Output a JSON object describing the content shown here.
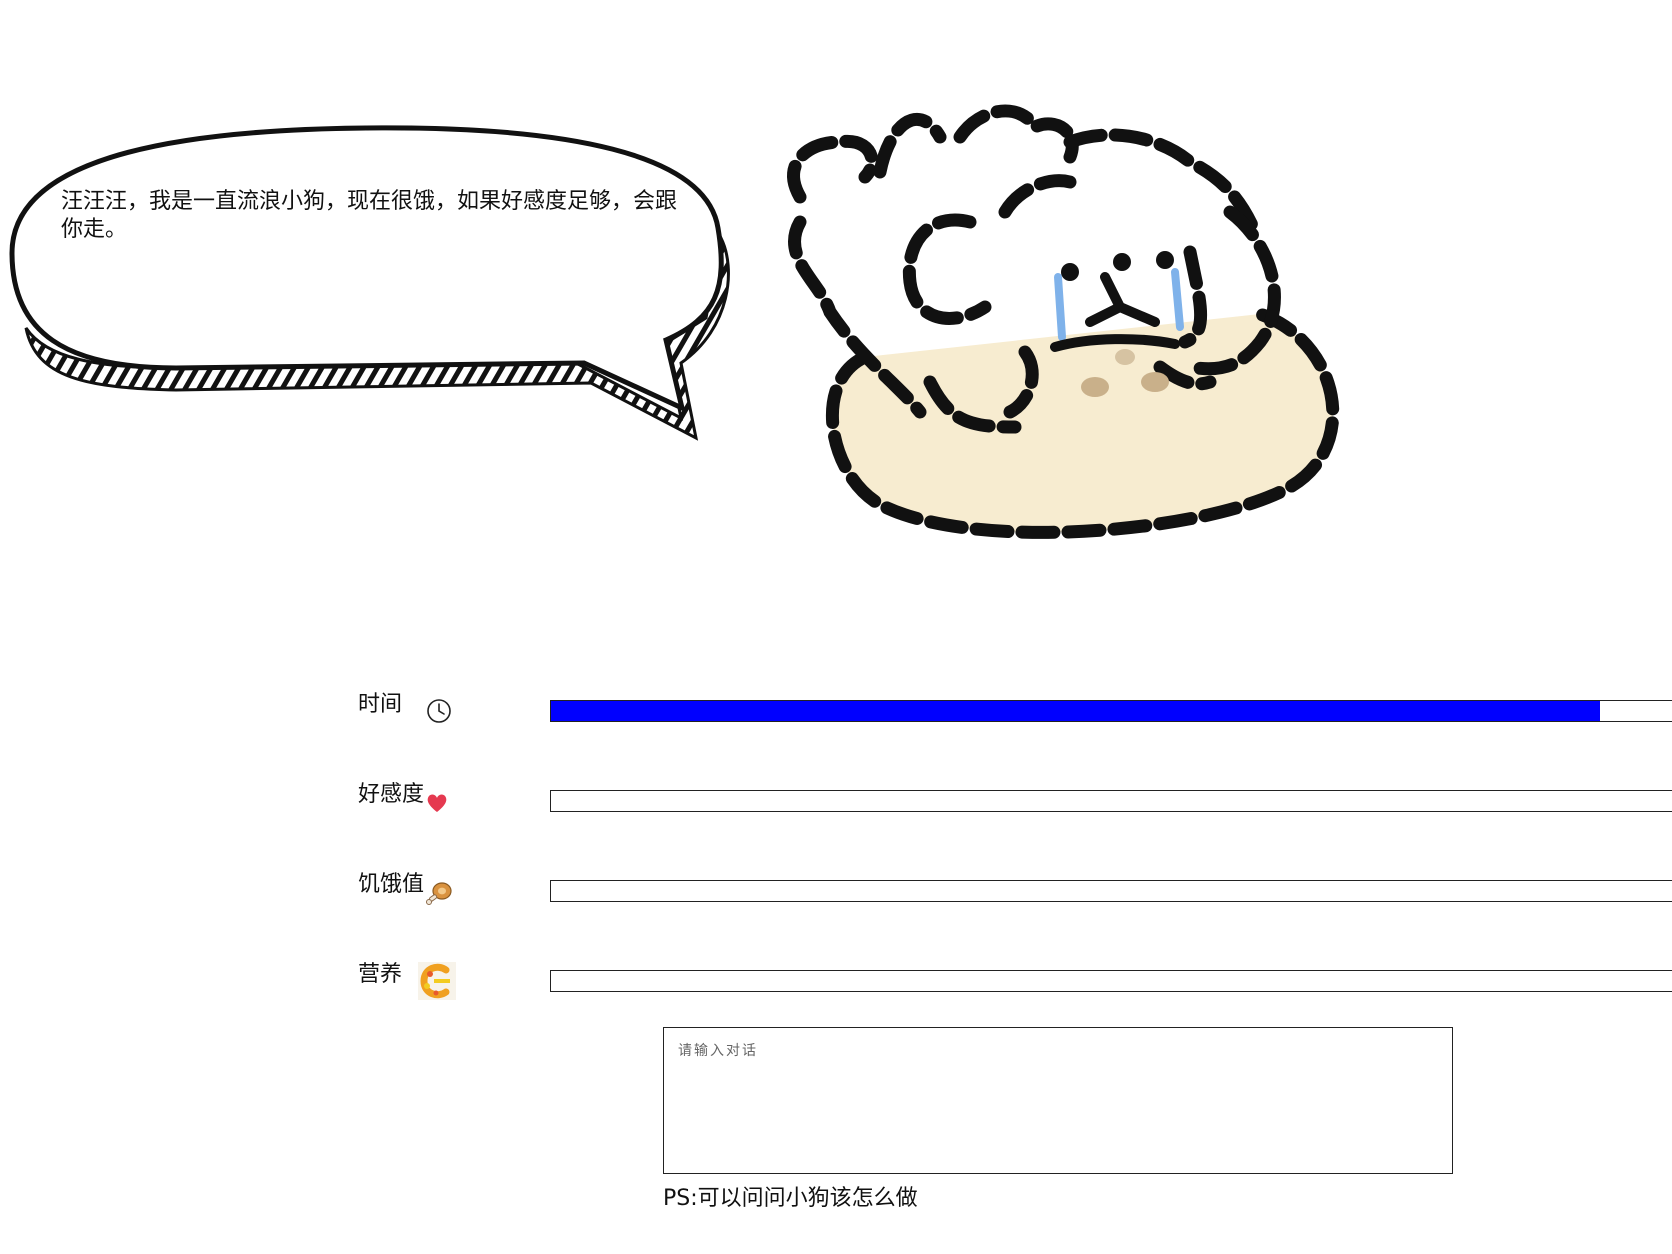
{
  "bubble": {
    "text": "汪汪汪，我是一直流浪小狗，现在很饿，如果好感度足够，会跟你走。"
  },
  "dog": {
    "icon": "crying-dog-illustration"
  },
  "stats": [
    {
      "label": "时间",
      "icon": "clock-icon",
      "fill_percent": 93
    },
    {
      "label": "好感度",
      "icon": "heart-icon",
      "fill_percent": 0
    },
    {
      "label": "饥饿值",
      "icon": "drumstick-icon",
      "fill_percent": 0
    },
    {
      "label": "营养",
      "icon": "vitamin-c-icon",
      "fill_percent": 0
    }
  ],
  "dialog": {
    "placeholder": "请输入对话"
  },
  "ps": "PS:可以问问小狗该怎么做",
  "colors": {
    "bar_fill": "#0000ff",
    "heart": "#e53950",
    "tear": "#7fb2ea",
    "bed": "#f7ecd0"
  }
}
